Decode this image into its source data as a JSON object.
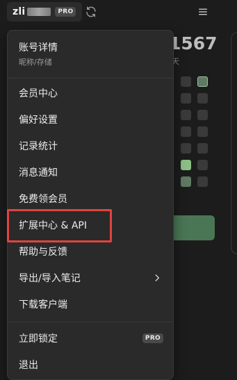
{
  "topbar": {
    "username": "zli",
    "pro_badge": "PRO"
  },
  "background": {
    "stat_text": "1567",
    "stat_sub": "天"
  },
  "dropdown": {
    "account": {
      "title": "账号详情",
      "subtitle": "昵称/存储"
    },
    "items": [
      {
        "label": "会员中心"
      },
      {
        "label": "偏好设置"
      },
      {
        "label": "记录统计"
      },
      {
        "label": "消息通知"
      },
      {
        "label": "免费领会员"
      },
      {
        "label": "扩展中心 & API"
      },
      {
        "label": "帮助与反馈"
      },
      {
        "label": "导出/导入笔记"
      },
      {
        "label": "下载客户端"
      }
    ],
    "footer_items": [
      {
        "label": "立即锁定",
        "badge": "PRO"
      },
      {
        "label": "退出"
      }
    ]
  },
  "colors": {
    "highlight": "#e0443f",
    "accent_green": "#4a7656"
  }
}
